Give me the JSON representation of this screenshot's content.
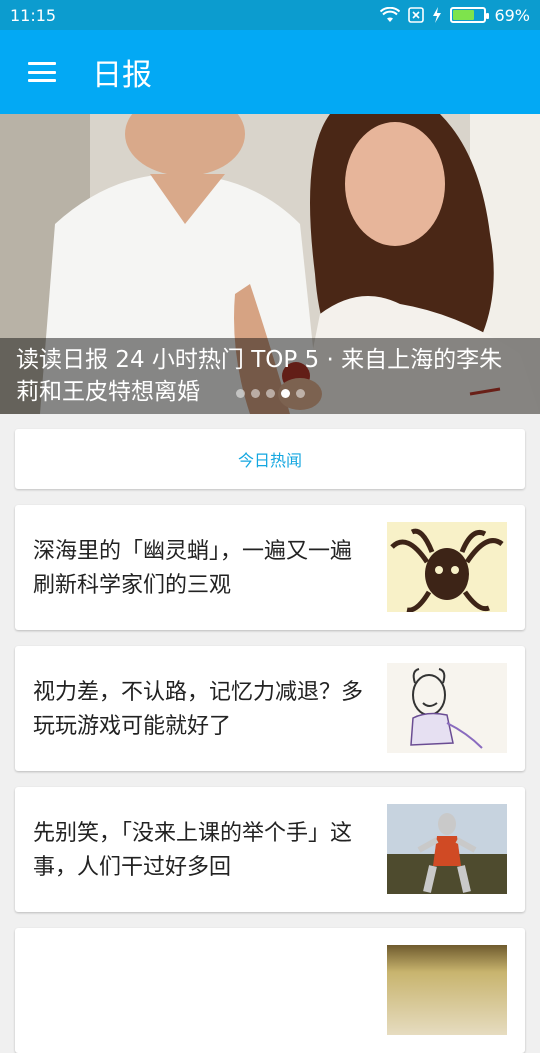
{
  "status_bar": {
    "time": "11:15",
    "battery_text": "69%",
    "battery_level": 0.69,
    "icons": [
      "wifi-icon",
      "sim-card-icon",
      "charging-bolt-icon",
      "battery-icon"
    ]
  },
  "appbar": {
    "title": "日报",
    "menu_icon": "hamburger-menu-icon"
  },
  "hero": {
    "title": "读读日报 24 小时热门 TOP 5 · 来自上海的李朱莉和王皮特想离婚",
    "dots_total": 5,
    "dots_active_index": 3
  },
  "section": {
    "label": "今日热闻"
  },
  "news": [
    {
      "title": "深海里的「幽灵蛸」，一遍又一遍刷新科学家们的三观",
      "thumb": "octopus-illustration"
    },
    {
      "title": "视力差，不认路，记忆力减退？多玩玩游戏可能就好了",
      "thumb": "sketch-illustration"
    },
    {
      "title": "先别笑，「没来上课的举个手」这事，人们干过好多回",
      "thumb": "ultraman-photo"
    },
    {
      "title": "",
      "thumb": "partial-photo"
    }
  ],
  "colors": {
    "status_bar": "#0c9ccf",
    "app_bar": "#03a9f4",
    "accent_text": "#14a7e0",
    "background": "#f0f0f0"
  }
}
